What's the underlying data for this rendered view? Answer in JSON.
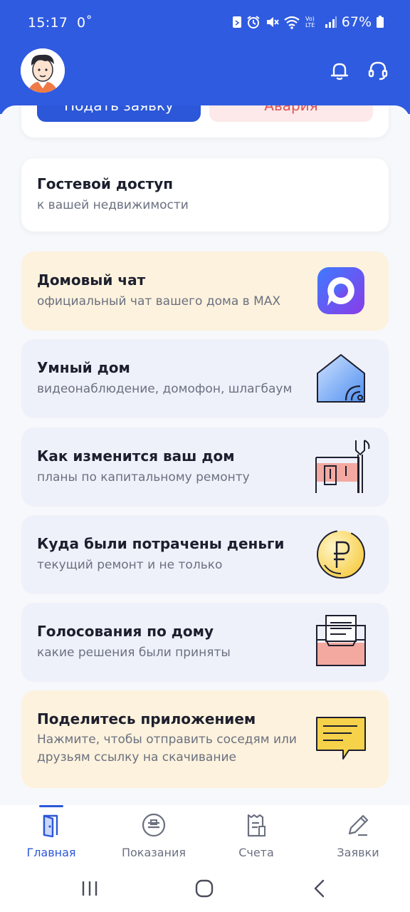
{
  "status_bar": {
    "time": "15:17",
    "temp": "0˚",
    "battery": "67%",
    "lte_label": "Vo)\nLTE"
  },
  "header": {
    "bg_color": "#2f5be0"
  },
  "top_card": {
    "apply_label": "Подать заявку",
    "alarm_label": "Авария"
  },
  "cards": [
    {
      "title": "Гостевой доступ",
      "subtitle": "к вашей недвижимости"
    },
    {
      "title": "Домовый чат",
      "subtitle": "официальный чат вашего дома в MAX",
      "icon": "max-app-icon"
    },
    {
      "title": "Умный дом",
      "subtitle": "видеонаблюдение, домофон, шлагбаум",
      "icon": "smart-home-icon"
    },
    {
      "title": "Как изменится ваш дом",
      "subtitle": "планы по капитальному ремонту",
      "icon": "repair-icon"
    },
    {
      "title": "Куда были потрачены деньги",
      "subtitle": "текущий ремонт и не только",
      "icon": "ruble-coin-icon"
    },
    {
      "title": "Голосования по дому",
      "subtitle": "какие решения были приняты",
      "icon": "ballot-box-icon"
    },
    {
      "title": "Поделитесь приложением",
      "subtitle_line1": "Нажмите, чтобы отправить соседям или",
      "subtitle_line2": "друзьям ссылку на скачивание",
      "icon": "message-icon"
    }
  ],
  "nav": [
    {
      "label": "Главная",
      "icon": "door-icon",
      "active": true
    },
    {
      "label": "Показания",
      "icon": "meter-icon",
      "active": false
    },
    {
      "label": "Счета",
      "icon": "receipt-icon",
      "active": false
    },
    {
      "label": "Заявки",
      "icon": "pencil-icon",
      "active": false
    }
  ],
  "colors": {
    "accent": "#2b57d8",
    "alarm_text": "#e0504f",
    "card_yellow": "#fdf2dd",
    "card_blue": "#eef1fa"
  }
}
